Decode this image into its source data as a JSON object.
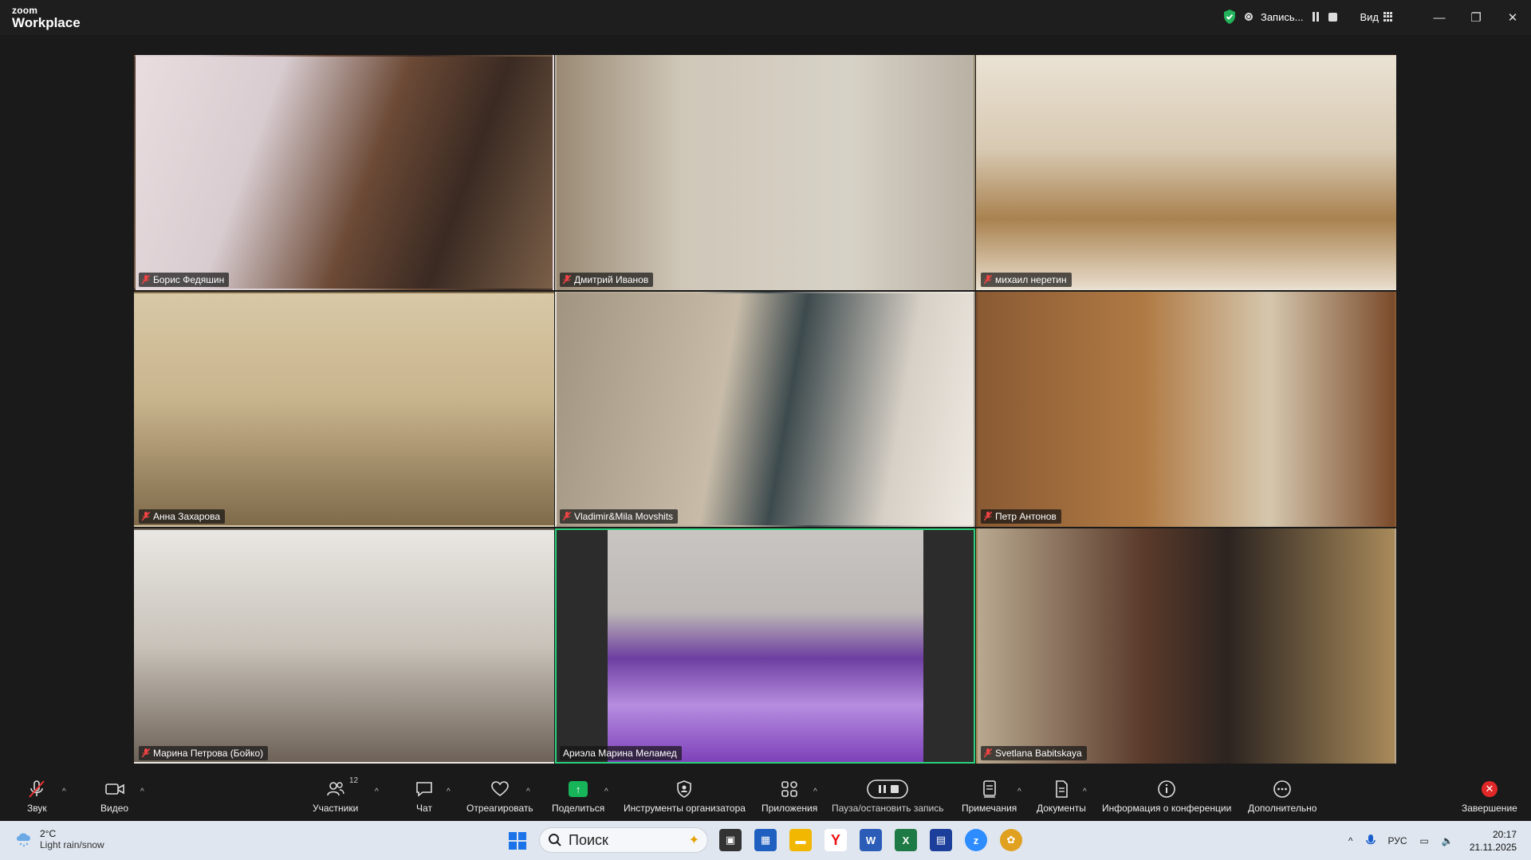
{
  "window": {
    "logo_small": "zoom",
    "logo_big": "Workplace",
    "recording_label": "Запись...",
    "view_label": "Вид",
    "minimize": "—",
    "restore": "❐",
    "close": "✕"
  },
  "participants": [
    {
      "name": "Борис Федяшин",
      "muted": true
    },
    {
      "name": "Дмитрий Иванов",
      "muted": true
    },
    {
      "name": "михаил неретин",
      "muted": true
    },
    {
      "name": "Анна Захарова",
      "muted": true
    },
    {
      "name": "Vladimir&Mila Movshits",
      "muted": true
    },
    {
      "name": "Петр Антонов",
      "muted": true
    },
    {
      "name": "Марина Петрова (Бойко)",
      "muted": true
    },
    {
      "name": "Ариэла Марина Меламед",
      "muted": false,
      "active_speaker": true
    },
    {
      "name": "Svetlana Babitskaya",
      "muted": true
    }
  ],
  "toolbar": {
    "audio": "Звук",
    "video": "Видео",
    "participants": "Участники",
    "participants_count": "12",
    "chat": "Чат",
    "react": "Отреагировать",
    "share": "Поделиться",
    "host_tools": "Инструменты организатора",
    "apps": "Приложения",
    "pause_record": "Пауза/остановить запись",
    "notes": "Примечания",
    "docs": "Документы",
    "meeting_info": "Информация о конференции",
    "more": "Дополнительно",
    "end": "Завершение"
  },
  "taskbar": {
    "temp": "2°C",
    "condition": "Light rain/snow",
    "search_placeholder": "Поиск",
    "lang": "РУС",
    "time": "20:17",
    "date": "21.11.2025"
  },
  "colors": {
    "active_border": "#2ad17b",
    "share_green": "#17b45a",
    "end_red": "#e02828",
    "shield_green": "#22b35a"
  }
}
